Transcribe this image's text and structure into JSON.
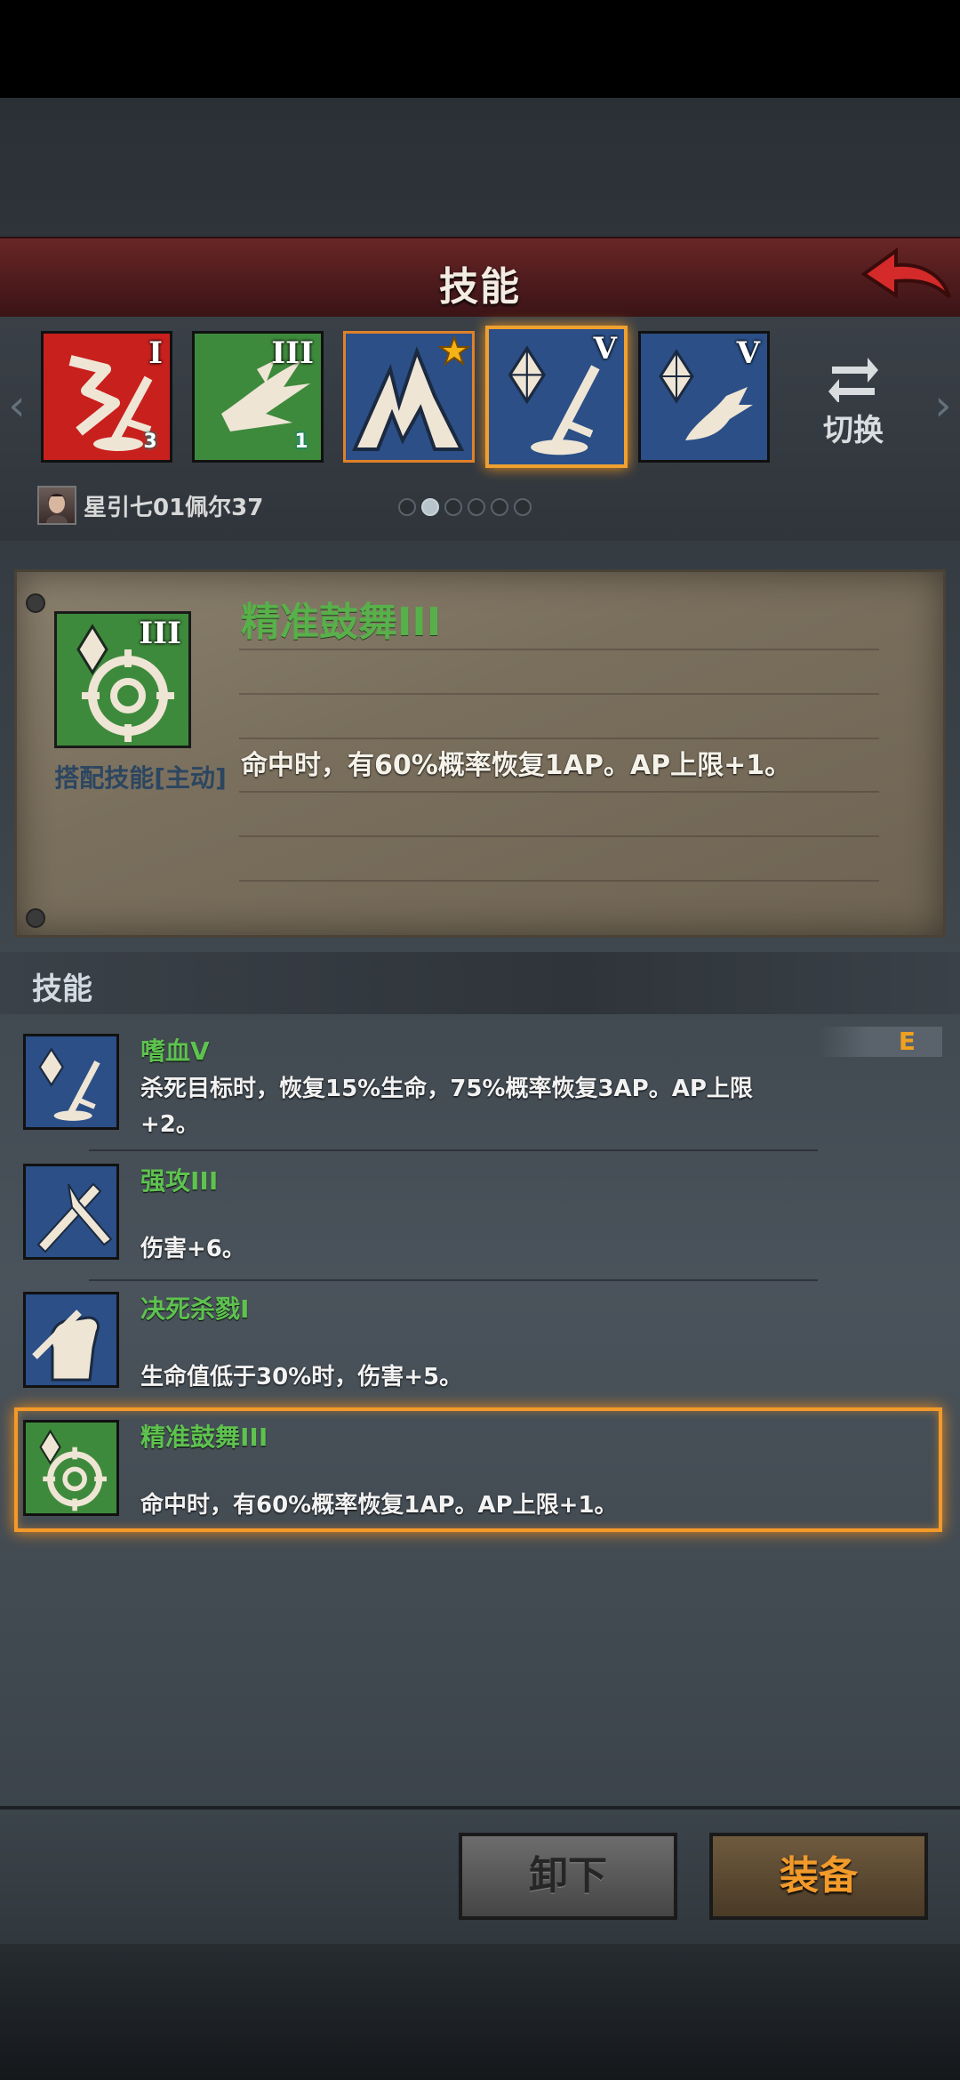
{
  "header": {
    "title": "技能",
    "back_icon": "back-arrow-icon",
    "accent": "#d22a2a"
  },
  "skillbar": {
    "slots": [
      {
        "numeral": "I",
        "count": "3",
        "bg": "#c8201d",
        "icon": "slash-sword-icon"
      },
      {
        "numeral": "III",
        "count": "1",
        "bg": "#3e8a3c",
        "icon": "blade-storm-icon"
      },
      {
        "numeral": "",
        "count": "",
        "bg": "#2b4f86",
        "icon": "claw-strike-icon",
        "star": true
      },
      {
        "numeral": "V",
        "count": "",
        "bg": "#2b4f86",
        "icon": "crystal-sword-icon",
        "selected": true
      },
      {
        "numeral": "V",
        "count": "",
        "bg": "#2b4f86",
        "icon": "crystal-beast-icon"
      }
    ],
    "switch_label": "切换",
    "player_name": "星引七01佩尔37",
    "page_dots": 6,
    "active_dot": 1
  },
  "detail": {
    "title": "精准鼓舞III",
    "numeral": "III",
    "type": "搭配技能[主动]",
    "description": "命中时，有60%概率恢复1AP。AP上限+1。",
    "icon": "crosshair-icon"
  },
  "section": {
    "title": "技能"
  },
  "skills": [
    {
      "name": "嗜血V",
      "description": "杀死目标时，恢复15%生命，75%概率恢复3AP。AP上限+2。",
      "badge": "E",
      "icon": "crystal-sword-icon",
      "bg": "#2b4f86"
    },
    {
      "name": "强攻III",
      "description": "伤害+6。",
      "icon": "crossed-blades-icon",
      "bg": "#2b4f86"
    },
    {
      "name": "决死杀戮I",
      "description": "生命值低于30%时，伤害+5。",
      "icon": "fist-icon",
      "bg": "#2b4f86"
    },
    {
      "name": "精准鼓舞III",
      "description": "命中时，有60%概率恢复1AP。AP上限+1。",
      "icon": "crosshair-icon",
      "bg": "#3e8a3c"
    }
  ],
  "buttons": {
    "unequip": "卸下",
    "equip": "装备"
  }
}
